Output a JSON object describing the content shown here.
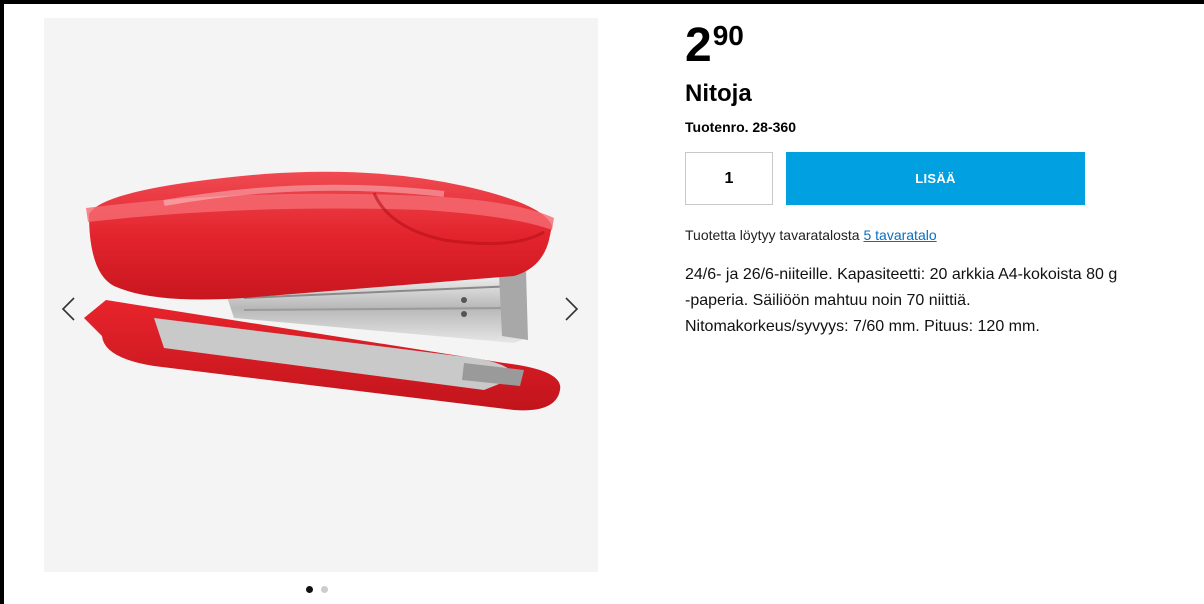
{
  "gallery": {
    "image_alt": "Nitoja",
    "prev_icon": "chevron-left-icon",
    "next_icon": "chevron-right-icon",
    "slide_count": 2,
    "active_slide": 1
  },
  "product": {
    "price_integer": "2",
    "price_decimal": "90",
    "name": "Nitoja",
    "product_number": "Tuotenro. 28-360"
  },
  "cart": {
    "quantity": "1",
    "add_label": "LISÄÄ"
  },
  "availability": {
    "text": "Tuotetta löytyy tavaratalosta ",
    "link_text": "5 tavaratalo"
  },
  "description": {
    "lines": [
      "24/6- ja 26/6-niiteille. Kapasiteetti: 20 arkkia A4-kokoista 80 g",
      "-paperia. Säiliöön mahtuu noin 70 niittiä.",
      "Nitomakorkeus/syvyys: 7/60 mm. Pituus: 120 mm."
    ]
  },
  "colors": {
    "accent": "#00a0e1",
    "link": "#0a6ebd",
    "gallery_bg": "#f4f4f4",
    "stapler_red": "#e8242c"
  }
}
